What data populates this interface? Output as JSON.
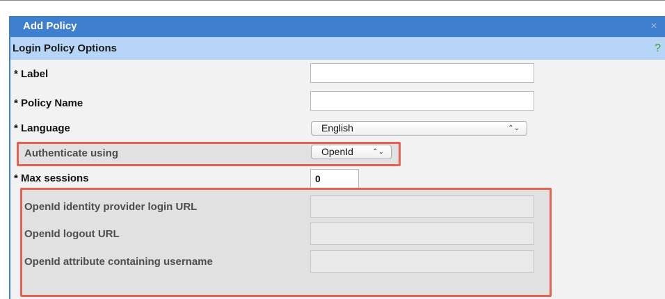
{
  "dialog": {
    "title": "Add Policy",
    "close_glyph": "×"
  },
  "section": {
    "title": "Login Policy Options",
    "help_glyph": "?"
  },
  "fields": {
    "label": {
      "label": "* Label",
      "value": ""
    },
    "policy_name": {
      "label": "* Policy Name",
      "value": ""
    },
    "language": {
      "label": "* Language",
      "selected": "English"
    },
    "authenticate_using": {
      "label": "Authenticate using",
      "selected": "OpenId"
    },
    "max_sessions": {
      "label": "* Max sessions",
      "value": "0"
    },
    "openid_login_url": {
      "label": "OpenId identity provider login URL",
      "value": ""
    },
    "openid_logout_url": {
      "label": "OpenId logout URL",
      "value": ""
    },
    "openid_username_attr": {
      "label": "OpenId attribute containing username",
      "value": ""
    }
  },
  "select_arrows_glyph": "⌃⌄",
  "colors": {
    "title_bar": "#3f7fcf",
    "section_header": "#b7d6f7",
    "help_icon": "#2aa52a",
    "highlight_border": "#e6614f"
  }
}
